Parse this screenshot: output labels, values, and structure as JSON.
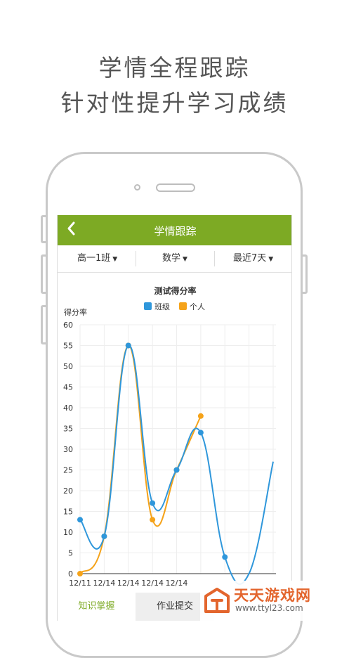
{
  "headline": {
    "line1": "学情全程跟踪",
    "line2": "针对性提升学习成绩"
  },
  "app": {
    "title": "学情跟踪",
    "back_icon": "chevron-left-icon"
  },
  "filters": [
    {
      "label": "高一1班"
    },
    {
      "label": "数学"
    },
    {
      "label": "最近7天"
    }
  ],
  "tabs": [
    {
      "label": "知识掌握",
      "active": true
    },
    {
      "label": "作业提交",
      "active": false
    }
  ],
  "colors": {
    "accent": "#7daa24",
    "class": "#2f97db",
    "personal": "#f5a31a"
  },
  "chart_data": {
    "type": "line",
    "title": "测试得分率",
    "ylabel": "得分率",
    "ylim": [
      0,
      60
    ],
    "yticks": [
      0,
      5,
      10,
      15,
      20,
      25,
      30,
      35,
      40,
      45,
      50,
      55,
      60
    ],
    "x": [
      "12/11",
      "12/14",
      "12/14",
      "12/14",
      "12/14",
      "",
      "",
      "",
      ""
    ],
    "legend": {
      "position": "top"
    },
    "series": [
      {
        "name": "班级",
        "color": "#2f97db",
        "values": [
          13,
          9,
          55,
          17,
          25,
          34,
          4,
          0,
          27
        ]
      },
      {
        "name": "个人",
        "color": "#f5a31a",
        "values": [
          0,
          9,
          55,
          13,
          25,
          38,
          null,
          null,
          null
        ]
      }
    ]
  },
  "watermark": {
    "brand": "天天游戏网",
    "url": "www.ttyl23.com"
  }
}
